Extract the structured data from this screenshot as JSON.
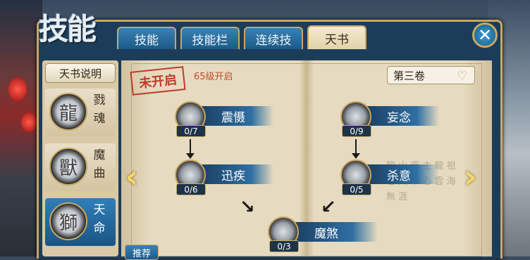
{
  "window": {
    "title": "技能",
    "close_icon": "close-icon"
  },
  "tabs": [
    {
      "label": "技能",
      "active": false
    },
    {
      "label": "技能栏",
      "active": false
    },
    {
      "label": "连续技",
      "active": false
    },
    {
      "label": "天书",
      "active": true
    }
  ],
  "sidebar": {
    "description_button": "天书说明",
    "books": [
      {
        "name": "戮魂",
        "icon": "dragon-icon",
        "active": false
      },
      {
        "name": "魔曲",
        "icon": "flame-beast-icon",
        "active": false
      },
      {
        "name": "天命",
        "icon": "lion-mask-icon",
        "active": true
      }
    ],
    "recommend_button": "推荐"
  },
  "page": {
    "stamp": "未开启",
    "level_note": "65级开启",
    "volume_select": "第三卷",
    "skills": [
      {
        "name": "震慑",
        "count": "0/7"
      },
      {
        "name": "迅疾",
        "count": "0/6"
      },
      {
        "name": "妄念",
        "count": "0/9"
      },
      {
        "name": "杀意",
        "count": "0/5"
      },
      {
        "name": "魔煞",
        "count": "0/3"
      }
    ]
  },
  "colors": {
    "accent_gold": "#c9a762",
    "tab_blue": "#2f6fa3",
    "stamp_red": "#c0392b"
  }
}
